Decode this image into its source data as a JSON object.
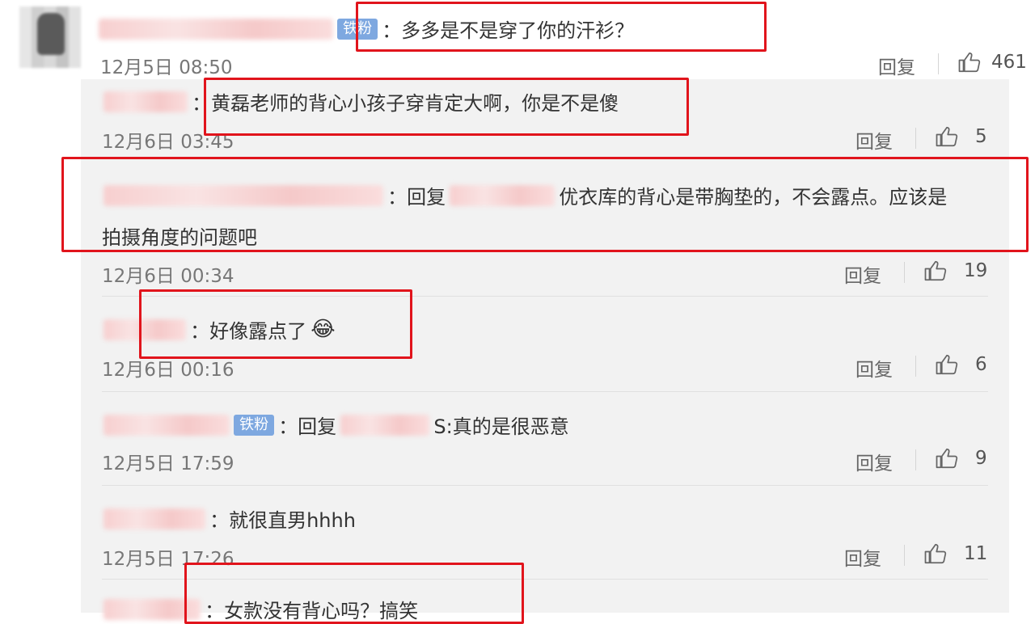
{
  "top_comment": {
    "badge": "铁粉",
    "text": "：多多是不是穿了你的汗衫？",
    "date": "12月5日 08:50",
    "reply_label": "回复",
    "likes": "461"
  },
  "replies": [
    {
      "text": "：黄磊老师的背心小孩子穿肯定大啊，你是不是傻",
      "date": "12月6日 03:45",
      "reply_label": "回复",
      "likes": "5"
    },
    {
      "text_prefix": "：回复",
      "text_main": "优衣库的背心是带胸垫的，不会露点。应该是",
      "text_cont": "拍摄角度的问题吧",
      "date": "12月6日 00:34",
      "reply_label": "回复",
      "likes": "19"
    },
    {
      "text": "：好像露点了",
      "emoji": "😂",
      "date": "12月6日 00:16",
      "reply_label": "回复",
      "likes": "6"
    },
    {
      "badge": "铁粉",
      "text_prefix": "：回复",
      "text_main": "S:真的是很恶意",
      "date": "12月5日 17:59",
      "reply_label": "回复",
      "likes": "9"
    },
    {
      "text": "：就很直男hhhh",
      "date": "12月5日 17:26",
      "reply_label": "回复",
      "likes": "11"
    },
    {
      "text": "：女款没有背心吗？搞笑"
    }
  ],
  "colors": {
    "highlight_box": "#e1141c",
    "badge_bg": "#7ea8e0",
    "panel_bg": "#f2f2f2"
  }
}
